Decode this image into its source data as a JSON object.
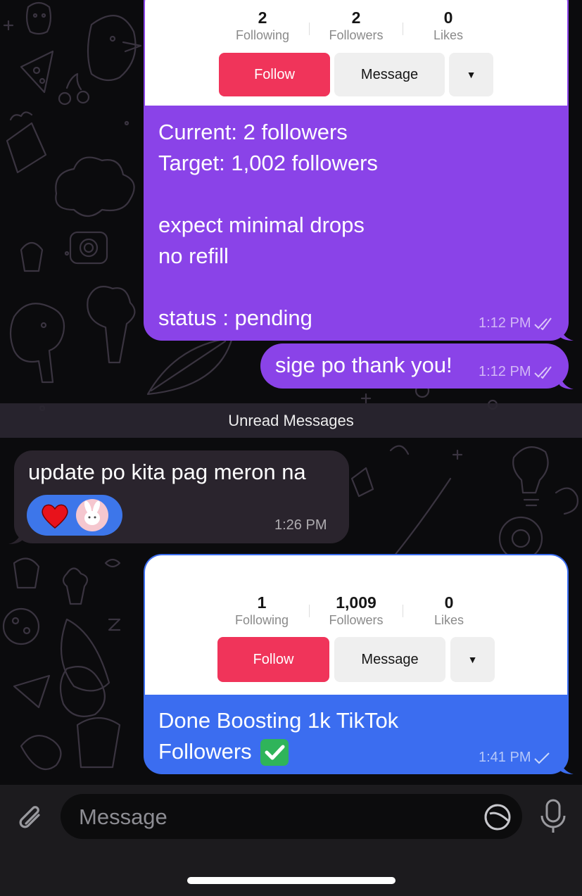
{
  "messages": {
    "first_profile": {
      "following_count": "2",
      "following_label": "Following",
      "followers_count": "2",
      "followers_label": "Followers",
      "likes_count": "0",
      "likes_label": "Likes",
      "follow_button": "Follow",
      "message_button": "Message",
      "dropdown_glyph": "▼"
    },
    "order_text": "Current: 2 followers\nTarget: 1,002 followers\n\nexpect minimal drops\nno refill\n\nstatus : pending",
    "order_time": "1:12 PM",
    "thanks_text": "sige po thank you!",
    "thanks_time": "1:12 PM",
    "unread_label": "Unread Messages",
    "incoming_text": "update po kita pag meron na",
    "incoming_time": "1:26 PM",
    "reactions": [
      "heart",
      "bunny-avatar"
    ],
    "second_profile": {
      "following_count": "1",
      "following_label": "Following",
      "followers_count": "1,009",
      "followers_label": "Followers",
      "likes_count": "0",
      "likes_label": "Likes",
      "follow_button": "Follow",
      "message_button": "Message",
      "dropdown_glyph": "▼"
    },
    "done_text": "Done Boosting 1k TikTok\nFollowers",
    "done_time": "1:41 PM"
  },
  "composer": {
    "placeholder": "Message",
    "attach_icon": "paperclip-icon",
    "sticker_icon": "sticker-icon",
    "mic_icon": "microphone-icon"
  },
  "colors": {
    "outgoing_purple": "#8a43e8",
    "outgoing_blue": "#3b6df0",
    "incoming": "#2a242d",
    "tiktok_follow": "#f0345a"
  }
}
